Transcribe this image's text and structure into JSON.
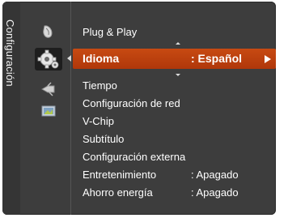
{
  "side_tab": {
    "title": "Configuración"
  },
  "category_icons": [
    {
      "name": "picture-icon",
      "selected": false
    },
    {
      "name": "setup-gear-icon",
      "selected": true
    },
    {
      "name": "input-icon",
      "selected": false
    },
    {
      "name": "application-icon",
      "selected": false
    }
  ],
  "menu": {
    "items": [
      {
        "label": "Plug & Play",
        "value": ""
      },
      {
        "label": "Idioma",
        "value": ": Español"
      },
      {
        "label": "Tiempo",
        "value": ""
      },
      {
        "label": "Configuración de red",
        "value": ""
      },
      {
        "label": "V-Chip",
        "value": ""
      },
      {
        "label": "Subtítulo",
        "value": ""
      },
      {
        "label": "Configuración externa",
        "value": ""
      },
      {
        "label": "Entretenimiento",
        "value": ": Apagado"
      },
      {
        "label": "Ahorro energía",
        "value": ": Apagado"
      }
    ],
    "selected_index": 1
  },
  "colors": {
    "panel_bg": "#3d3d3d",
    "highlight_bg": "#c0430f",
    "text": "#ffffff"
  }
}
